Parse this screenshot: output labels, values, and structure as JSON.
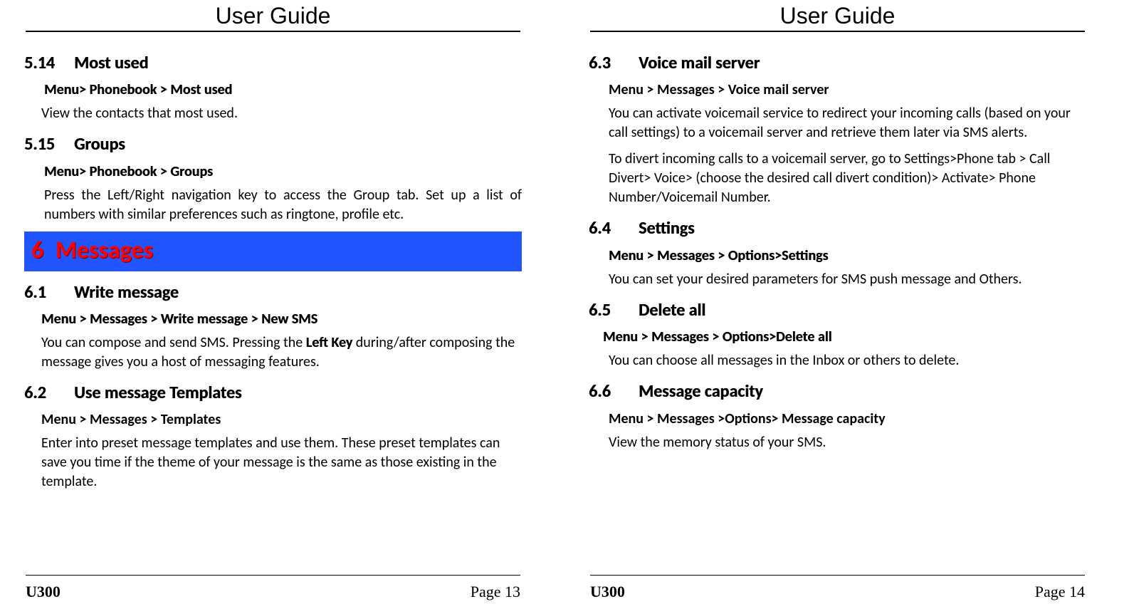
{
  "pages": {
    "left": {
      "header": "User Guide",
      "s514": {
        "num": "5.14",
        "title": "Most used",
        "path": "Menu> Phonebook > Most used",
        "body": "View the contacts that most used."
      },
      "s515": {
        "num": "5.15",
        "title": "Groups",
        "path": "Menu> Phonebook > Groups",
        "body": "Press the Left/Right navigation key to access the Group tab. Set up a list of numbers with similar preferences such as ringtone, profile etc."
      },
      "chapter": {
        "num": "6",
        "title": "Messages"
      },
      "s61": {
        "num": "6.1",
        "title": "Write message",
        "path": "Menu > Messages > Write message > New SMS",
        "body_pre": "You can compose and send SMS. Pressing the ",
        "body_key": "Left Key",
        "body_post": " during/after composing the message gives you a host of messaging features."
      },
      "s62": {
        "num": "6.2",
        "title": "Use message Templates",
        "path": "Menu > Messages > Templates",
        "body": "Enter into preset message templates and use them. These preset templates can save you time if the theme of your message is the same as those existing in the template."
      },
      "footer": {
        "model": "U300",
        "page": "Page 13"
      }
    },
    "right": {
      "header": "User Guide",
      "s63": {
        "num": "6.3",
        "title": "Voice mail server",
        "path": "Menu > Messages > Voice mail server",
        "body1": "You can activate voicemail service to redirect your incoming calls (based on your call settings) to a voicemail server and retrieve them later via SMS alerts.",
        "body2": "To divert incoming calls to a voicemail server, go to Settings>Phone tab > Call Divert> Voice> (choose the desired call divert condition)> Activate> Phone Number/Voicemail Number."
      },
      "s64": {
        "num": "6.4",
        "title": "Settings",
        "path": "Menu > Messages > Options>Settings",
        "body": "You can set your desired parameters for SMS push message and Others."
      },
      "s65": {
        "num": "6.5",
        "title": "Delete all",
        "path": "Menu > Messages > Options>Delete all",
        "body": "You can choose all messages in the Inbox or others to delete."
      },
      "s66": {
        "num": "6.6",
        "title": "Message capacity",
        "path": "Menu > Messages >Options> Message capacity",
        "body": "View the memory status of your SMS."
      },
      "footer": {
        "model": "U300",
        "page": "Page 14"
      }
    }
  }
}
